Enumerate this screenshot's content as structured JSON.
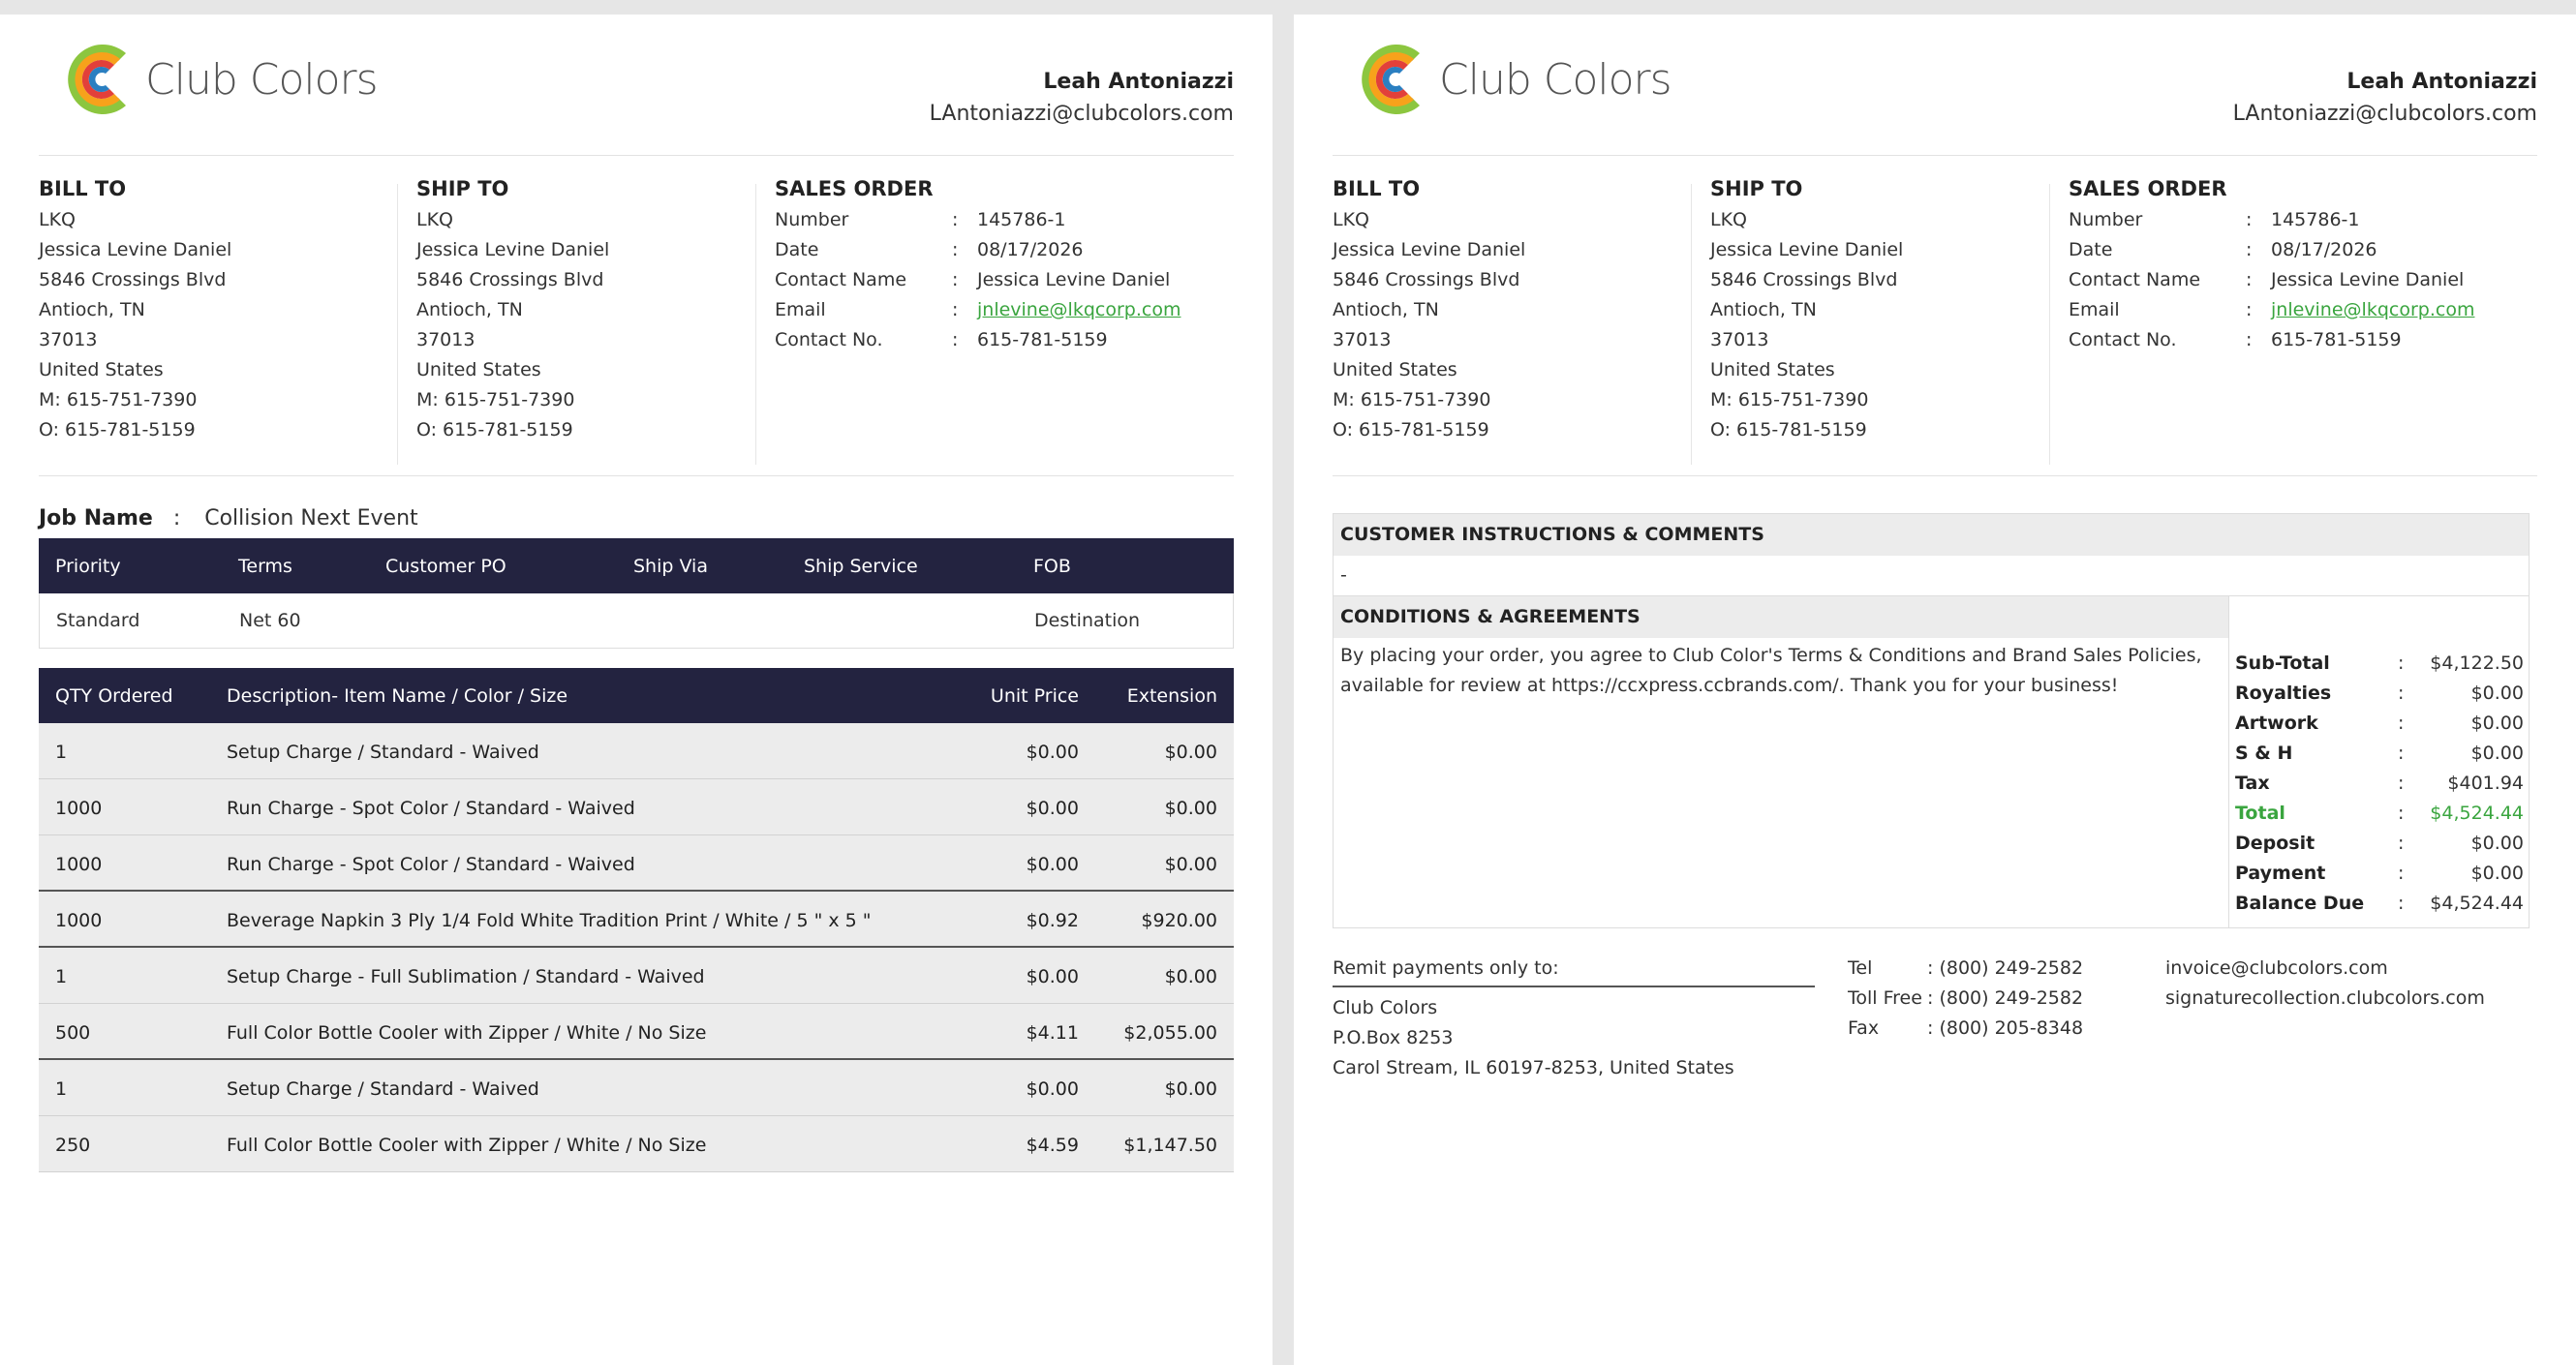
{
  "brand": {
    "name": "Club Colors",
    "accent": "#3aa53f",
    "navy": "#232340"
  },
  "rep": {
    "name": "Leah Antoniazzi",
    "email": "LAntoniazzi@clubcolors.com"
  },
  "bill_to": {
    "title": "BILL TO",
    "lines": [
      "LKQ",
      "Jessica Levine Daniel",
      "5846 Crossings Blvd",
      "Antioch, TN",
      "37013",
      "United States",
      "M: 615-751-7390",
      "O: 615-781-5159"
    ]
  },
  "ship_to": {
    "title": "SHIP TO",
    "lines": [
      "LKQ",
      "Jessica Levine Daniel",
      "5846 Crossings Blvd",
      "Antioch, TN",
      "37013",
      "United States",
      "M: 615-751-7390",
      "O: 615-781-5159"
    ]
  },
  "sales_order": {
    "title": "SALES ORDER",
    "colon": ":",
    "rows": [
      {
        "label": "Number",
        "value": "145786-1"
      },
      {
        "label": "Date",
        "value": "08/17/2026"
      },
      {
        "label": "Contact Name",
        "value": "Jessica Levine Daniel"
      },
      {
        "label": "Email",
        "value": "jnlevine@lkqcorp.com"
      },
      {
        "label": "Contact No.",
        "value": "615-781-5159"
      }
    ]
  },
  "job": {
    "label": "Job Name",
    "colon": ":",
    "value": "Collision Next Event"
  },
  "order_info": {
    "headers": [
      "Priority",
      "Terms",
      "Customer PO",
      "Ship Via",
      "Ship Service",
      "FOB"
    ],
    "values": [
      "Standard",
      "Net 60",
      "",
      "",
      "",
      "Destination"
    ]
  },
  "items": {
    "headers": [
      "QTY Ordered",
      "Description- Item Name / Color / Size",
      "Unit Price",
      "Extension"
    ],
    "rows": [
      {
        "qty": "1",
        "desc": "Setup Charge / Standard - Waived",
        "price": "$0.00",
        "ext": "$0.00"
      },
      {
        "qty": "1000",
        "desc": "Run Charge - Spot Color / Standard - Waived",
        "price": "$0.00",
        "ext": "$0.00"
      },
      {
        "qty": "1000",
        "desc": "Run Charge - Spot Color / Standard - Waived",
        "price": "$0.00",
        "ext": "$0.00"
      },
      {
        "qty": "1000",
        "desc": "Beverage Napkin 3 Ply 1/4 Fold White Tradition Print / White / 5 \" x 5 \"",
        "price": "$0.92",
        "ext": "$920.00"
      },
      {
        "qty": "1",
        "desc": "Setup Charge - Full Sublimation / Standard - Waived",
        "price": "$0.00",
        "ext": "$0.00"
      },
      {
        "qty": "500",
        "desc": "Full Color Bottle Cooler with Zipper / White / No Size",
        "price": "$4.11",
        "ext": "$2,055.00"
      },
      {
        "qty": "1",
        "desc": "Setup Charge / Standard - Waived",
        "price": "$0.00",
        "ext": "$0.00"
      },
      {
        "qty": "250",
        "desc": "Full Color Bottle Cooler with Zipper / White / No Size",
        "price": "$4.59",
        "ext": "$1,147.50"
      }
    ]
  },
  "instructions": {
    "title": "CUSTOMER INSTRUCTIONS & COMMENTS",
    "value": "-"
  },
  "conditions": {
    "title": "CONDITIONS & AGREEMENTS",
    "text": "By placing your order, you agree to Club Color's Terms & Conditions and Brand Sales Policies, available for review at https://ccxpress.ccbrands.com/. Thank you for your business!"
  },
  "totals": {
    "colon": ":",
    "rows": [
      {
        "label": "Sub-Total",
        "value": "$4,122.50"
      },
      {
        "label": "Royalties",
        "value": "$0.00"
      },
      {
        "label": "Artwork",
        "value": "$0.00"
      },
      {
        "label": "S & H",
        "value": "$0.00"
      },
      {
        "label": "Tax",
        "value": "$401.94"
      },
      {
        "label": "Total",
        "value": "$4,524.44"
      },
      {
        "label": "Deposit",
        "value": "$0.00"
      },
      {
        "label": "Payment",
        "value": "$0.00"
      },
      {
        "label": "Balance Due",
        "value": "$4,524.44"
      }
    ]
  },
  "remit": {
    "title": "Remit payments only to:",
    "lines": [
      "Club Colors",
      "P.O.Box 8253",
      "Carol Stream, IL 60197-8253, United States"
    ]
  },
  "contact": {
    "rows": [
      {
        "label": "Tel",
        "value": ": (800) 249-2582"
      },
      {
        "label": "Toll Free",
        "value": ": (800) 249-2582"
      },
      {
        "label": "Fax",
        "value": ": (800) 205-8348"
      }
    ]
  },
  "web": {
    "lines": [
      "invoice@clubcolors.com",
      "signaturecollection.clubcolors.com"
    ]
  }
}
